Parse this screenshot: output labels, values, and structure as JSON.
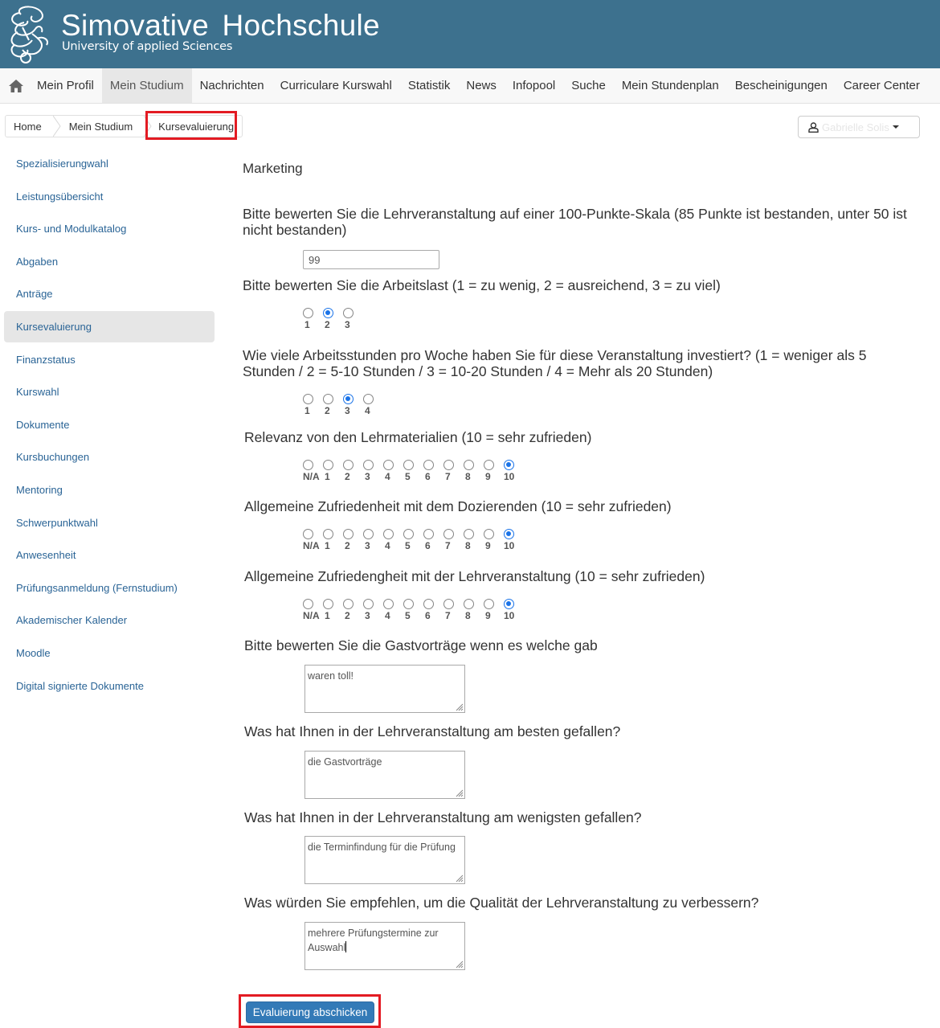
{
  "header": {
    "title": "Simovative  Hochschule",
    "subtitle": "University of applied Sciences",
    "logo_icon": "ornamental-s-logo"
  },
  "nav": {
    "home_icon": "home-icon",
    "items": [
      {
        "label": "Mein Profil",
        "active": false
      },
      {
        "label": "Mein Studium",
        "active": true
      },
      {
        "label": "Nachrichten",
        "active": false
      },
      {
        "label": "Curriculare Kurswahl",
        "active": false
      },
      {
        "label": "Statistik",
        "active": false
      },
      {
        "label": "News",
        "active": false
      },
      {
        "label": "Infopool",
        "active": false
      },
      {
        "label": "Suche",
        "active": false
      },
      {
        "label": "Mein Stundenplan",
        "active": false
      },
      {
        "label": "Bescheinigungen",
        "active": false
      },
      {
        "label": "Career Center",
        "active": false
      }
    ]
  },
  "breadcrumb": {
    "items": [
      "Home",
      "Mein Studium",
      "Kursevaluierung"
    ]
  },
  "user": {
    "name": "Gabrielle Solis",
    "icon": "user-icon"
  },
  "sidebar": {
    "items": [
      {
        "label": "Spezialisierungwahl",
        "active": false
      },
      {
        "label": "Leistungsübersicht",
        "active": false
      },
      {
        "label": "Kurs- und Modulkatalog",
        "active": false
      },
      {
        "label": "Abgaben",
        "active": false
      },
      {
        "label": "Anträge",
        "active": false
      },
      {
        "label": "Kursevaluierung",
        "active": true
      },
      {
        "label": "Finanzstatus",
        "active": false
      },
      {
        "label": "Kurswahl",
        "active": false
      },
      {
        "label": "Dokumente",
        "active": false
      },
      {
        "label": "Kursbuchungen",
        "active": false
      },
      {
        "label": "Mentoring",
        "active": false
      },
      {
        "label": "Schwerpunktwahl",
        "active": false
      },
      {
        "label": "Anwesenheit",
        "active": false
      },
      {
        "label": "Prüfungsanmeldung (Fernstudium)",
        "active": false
      },
      {
        "label": "Akademischer Kalender",
        "active": false
      },
      {
        "label": "Moodle",
        "active": false
      },
      {
        "label": "Digital signierte Dokumente",
        "active": false
      }
    ]
  },
  "form": {
    "course": "Marketing",
    "q1": {
      "label": "Bitte bewerten Sie die Lehrveranstaltung auf einer 100-Punkte-Skala (85 Punkte ist bestanden, unter 50 ist nicht bestanden)",
      "value": "99"
    },
    "q2": {
      "label": "Bitte bewerten Sie die Arbeitslast (1 = zu wenig, 2 = ausreichend, 3 = zu viel)",
      "options": [
        "1",
        "2",
        "3"
      ],
      "selected": "2"
    },
    "q3": {
      "label": "Wie viele Arbeitsstunden pro Woche haben Sie für diese Veranstaltung investiert? (1 = weniger als 5 Stunden / 2 = 5-10 Stunden / 3 = 10-20 Stunden / 4 = Mehr als 20 Stunden)",
      "options": [
        "1",
        "2",
        "3",
        "4"
      ],
      "selected": "3"
    },
    "q4": {
      "label": "Relevanz von den Lehrmaterialien (10 = sehr zufrieden)",
      "options": [
        "N/A",
        "1",
        "2",
        "3",
        "4",
        "5",
        "6",
        "7",
        "8",
        "9",
        "10"
      ],
      "selected": "10"
    },
    "q5": {
      "label": "Allgemeine Zufriedenheit mit dem Dozierenden (10 = sehr zufrieden)",
      "options": [
        "N/A",
        "1",
        "2",
        "3",
        "4",
        "5",
        "6",
        "7",
        "8",
        "9",
        "10"
      ],
      "selected": "10"
    },
    "q6": {
      "label": "Allgemeine Zufriedengheit mit der Lehrveranstaltung (10 = sehr zufrieden)",
      "options": [
        "N/A",
        "1",
        "2",
        "3",
        "4",
        "5",
        "6",
        "7",
        "8",
        "9",
        "10"
      ],
      "selected": "10"
    },
    "q7": {
      "label": "Bitte bewerten Sie die Gastvorträge wenn es welche gab",
      "value": "waren toll!"
    },
    "q8": {
      "label": "Was hat Ihnen in der Lehrveranstaltung am besten gefallen?",
      "value": "die Gastvorträge"
    },
    "q9": {
      "label": "Was hat Ihnen in der Lehrveranstaltung am wenigsten gefallen?",
      "value": "die Terminfindung für die Prüfung"
    },
    "q10": {
      "label": "Was würden Sie empfehlen, um die Qualität der Lehrveranstaltung zu verbessern?",
      "value": "mehrere Prüfungstermine zur Auswahl"
    },
    "submit_label": "Evaluierung abschicken"
  },
  "colors": {
    "banner": "#3d718e",
    "link": "#2a6496",
    "radio_checked": "#1a73e8",
    "button": "#337ab7",
    "highlight": "#e31b23"
  }
}
